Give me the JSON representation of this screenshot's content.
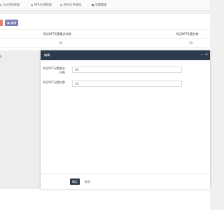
{
  "tabs": [
    {
      "label": "出击等待管理",
      "active": false
    },
    {
      "label": "NFAI卡牌管理",
      "active": false
    },
    {
      "label": "NFAI订单管理",
      "active": false
    },
    {
      "label": "设置管理",
      "active": true
    }
  ],
  "toolbar": {
    "edit_label": "编辑"
  },
  "table": {
    "headers": [
      "购买NFT闲置最多份数",
      "购买NFT闲置份数"
    ],
    "row": [
      "30",
      "10"
    ],
    "side_text": "b"
  },
  "modal": {
    "title": "编辑",
    "minimize_glyph": "—",
    "close_glyph": "ck",
    "fields": [
      {
        "label": "购买NFT闲置最多份数",
        "value": "30"
      },
      {
        "label": "购买NFT闲置份数",
        "value": "10"
      }
    ],
    "ok_label": "确定",
    "cancel_label": "取消"
  },
  "colors": {
    "header_bg": "#2e3b4c",
    "accent_blue": "#7b80b8",
    "accent_red": "#e9826e"
  }
}
